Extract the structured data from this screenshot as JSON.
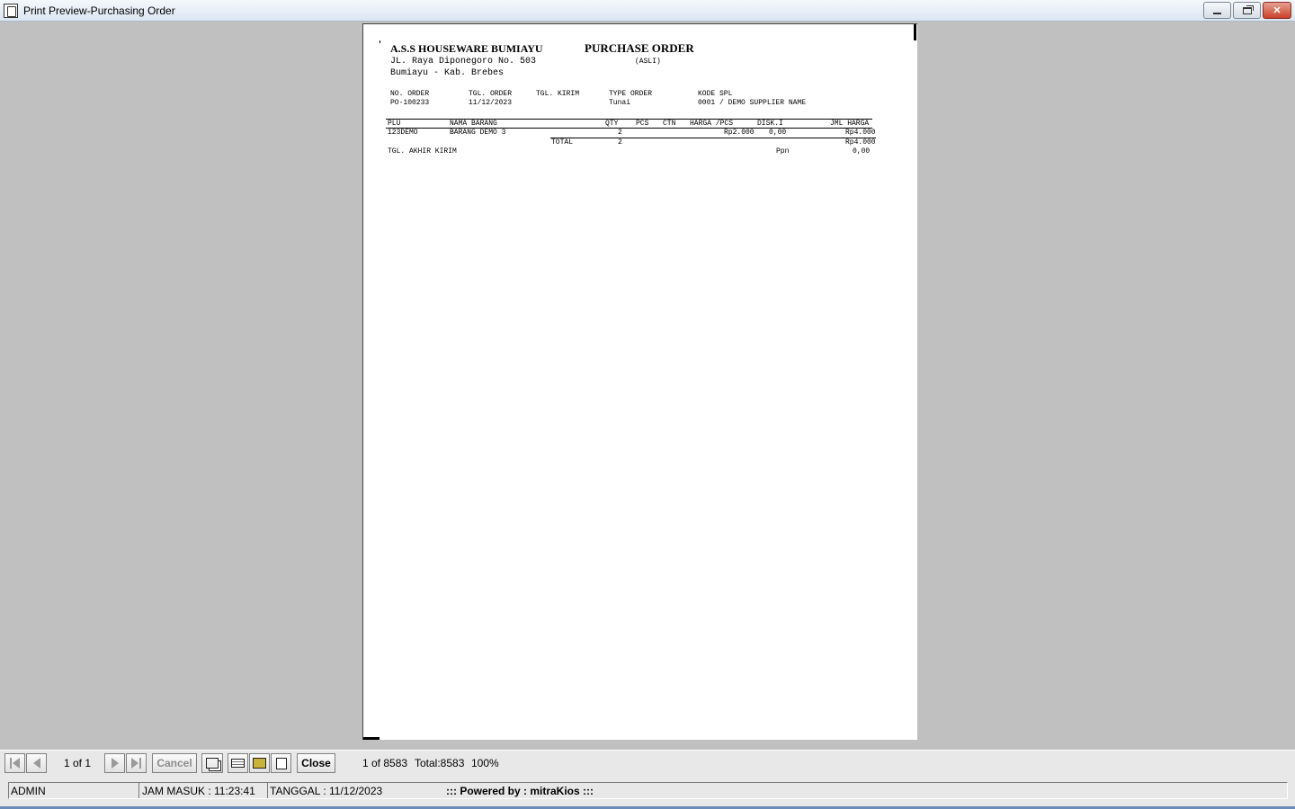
{
  "window": {
    "title": "Print Preview-Purchasing Order",
    "minimize_icon": "minimize-icon",
    "restore_icon": "restore-icon",
    "close_icon": "close-icon"
  },
  "report": {
    "company_name": "A.S.S HOUSEWARE BUMIAYU",
    "address_line1": "JL. Raya Diponegoro No. 503",
    "address_line2": "Bumiayu - Kab. Brebes",
    "doc_title": "PURCHASE ORDER",
    "doc_copy": "(ASLI)",
    "info_headers": {
      "no_order": "NO. ORDER",
      "tgl_order": "TGL. ORDER",
      "tgl_kirim": "TGL. KIRIM",
      "type_order": "TYPE ORDER",
      "kode_spl": "KODE SPL"
    },
    "info_values": {
      "no_order": "PO-100233",
      "tgl_order": "11/12/2023",
      "tgl_kirim": "",
      "type_order": "Tunai",
      "kode_spl": "0001  /  DEMO SUPPLIER NAME"
    },
    "columns": {
      "plu": "PLU",
      "nama_barang": "NAMA BARANG",
      "qty": "QTY",
      "pcs": "PCS",
      "ctn": "CTN",
      "harga_pcs": "HARGA /PCS",
      "disk": "DISK.I",
      "jml_harga": "JML HARGA"
    },
    "rows": [
      {
        "plu": "123DEMO",
        "nama_barang": "BARANG DEMO 3",
        "qty": "2",
        "harga_pcs": "Rp2.000",
        "disk": "0,00",
        "jml_harga": "Rp4.000"
      }
    ],
    "total_label": "TOTAL",
    "total_qty": "2",
    "total_amount": "Rp4.000",
    "tgl_akhir_kirim": "TGL. AKHIR KIRIM",
    "ppn_label": "Ppn",
    "ppn_value": "0,00"
  },
  "toolbar": {
    "first_icon": "first-page-icon",
    "prev_icon": "prev-page-icon",
    "page_indicator": "1 of 1",
    "next_icon": "next-page-icon",
    "last_icon": "last-page-icon",
    "cancel_label": "Cancel",
    "page_setup_icon": "page-setup-icon",
    "print_icon": "print-icon",
    "export_icon": "export-icon",
    "search_icon": "find-icon",
    "close_label": "Close",
    "record_indicator": "1 of 8583",
    "total": "Total:8583",
    "zoom": "100%"
  },
  "status": {
    "user": "ADMIN",
    "jam_masuk": "JAM MASUK : 11:23:41",
    "tanggal": "TANGGAL : 11/12/2023",
    "powered_by": "::: Powered by : mitraKios :::"
  }
}
